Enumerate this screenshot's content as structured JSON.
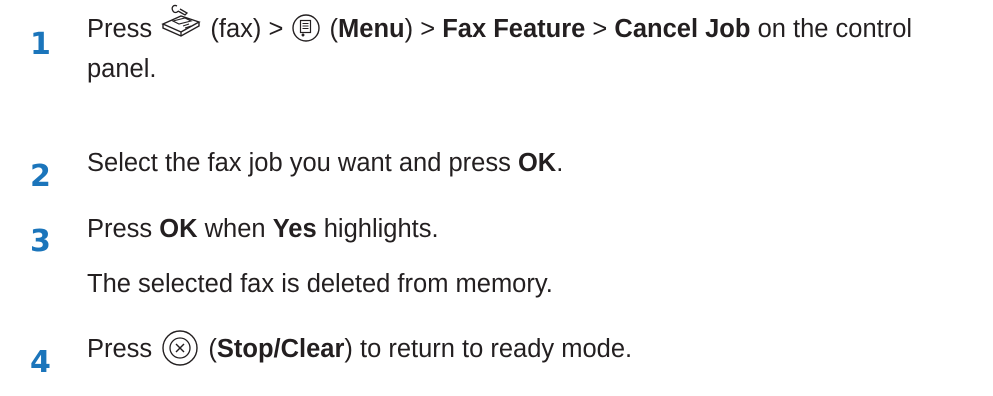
{
  "steps": [
    {
      "number": "1",
      "press": "Press",
      "fax_label": "(fax) >",
      "menu_label_open": "(",
      "menu_label": "Menu",
      "menu_label_close": ") >",
      "fax_feature": "Fax Feature",
      "sep": ">",
      "cancel_job": "Cancel Job",
      "tail_line1": "on the control",
      "tail_line2": "panel.",
      "icons": [
        "fax-icon",
        "menu-icon"
      ]
    },
    {
      "number": "2",
      "text_before": "Select the fax job you want and press",
      "ok": "OK",
      "text_after": "."
    },
    {
      "number": "3",
      "press": "Press",
      "ok": "OK",
      "when": "when",
      "yes": "Yes",
      "highlights": "highlights.",
      "note": "The selected fax is deleted from memory."
    },
    {
      "number": "4",
      "press": "Press",
      "paren_open": "(",
      "stop_clear": "Stop/Clear",
      "rest": ") to return to ready mode.",
      "icons": [
        "stop-clear-icon"
      ]
    }
  ],
  "colors": {
    "step_number": "#1b75bb",
    "text": "#231f20"
  }
}
